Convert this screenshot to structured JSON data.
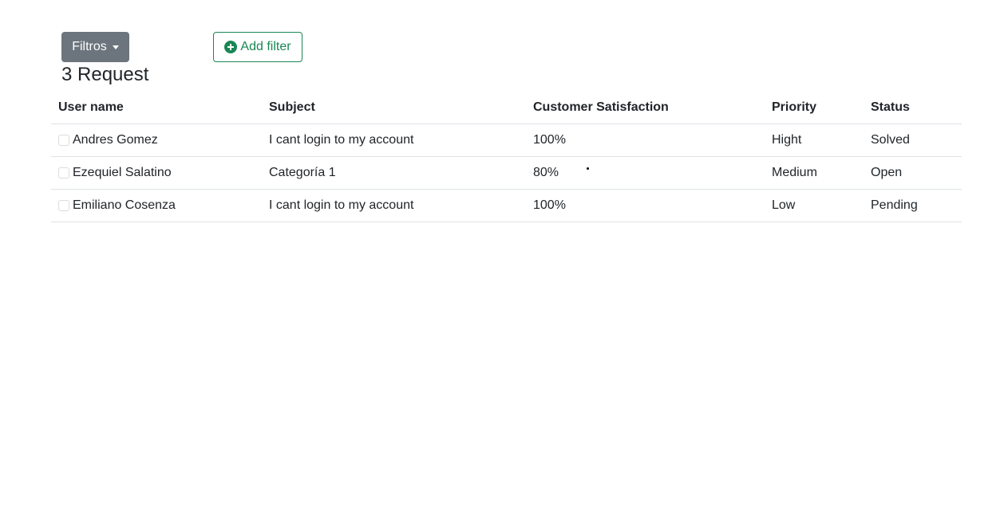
{
  "toolbar": {
    "filters_label": "Filtros",
    "add_filter_label": "Add filter"
  },
  "title": "3 Request",
  "table": {
    "headers": [
      "User name",
      "Subject",
      "Customer Satisfaction",
      "Priority",
      "Status"
    ],
    "rows": [
      {
        "user": "Andres Gomez",
        "subject": "I cant login to my account",
        "satisfaction": "100%",
        "priority": "Hight",
        "status": "Solved"
      },
      {
        "user": "Ezequiel Salatino",
        "subject": "Categoría 1",
        "satisfaction": "80%",
        "priority": "Medium",
        "status": "Open"
      },
      {
        "user": "Emiliano Cosenza",
        "subject": "I cant login to my account",
        "satisfaction": "100%",
        "priority": "Low",
        "status": "Pending"
      }
    ]
  },
  "colors": {
    "secondary": "#6c757d",
    "success": "#198754",
    "border": "#dee2e6"
  },
  "icons": {
    "add_filter": "plus-circle-icon",
    "filters": "caret-down-icon"
  }
}
